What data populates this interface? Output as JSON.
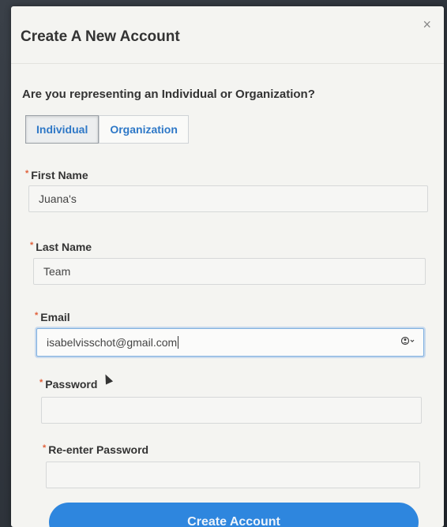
{
  "modal": {
    "title": "Create A New Account",
    "close_label": "×"
  },
  "account_type": {
    "question": "Are you representing an Individual or Organization?",
    "options": [
      {
        "label": "Individual",
        "selected": true
      },
      {
        "label": "Organization",
        "selected": false
      }
    ]
  },
  "form": {
    "required_marker": "*",
    "first_name": {
      "label": "First Name",
      "value": "Juana's"
    },
    "last_name": {
      "label": "Last Name",
      "value": "Team"
    },
    "email": {
      "label": "Email",
      "value": "isabelvisschot@gmail.com",
      "autofill_icon": "person-circle-icon"
    },
    "password": {
      "label": "Password",
      "value": ""
    },
    "reenter_password": {
      "label": "Re-enter Password",
      "value": ""
    }
  },
  "submit": {
    "label": "Create Account"
  },
  "colors": {
    "accent": "#2e86de",
    "required": "#e0603a",
    "link": "#2e78c7"
  }
}
